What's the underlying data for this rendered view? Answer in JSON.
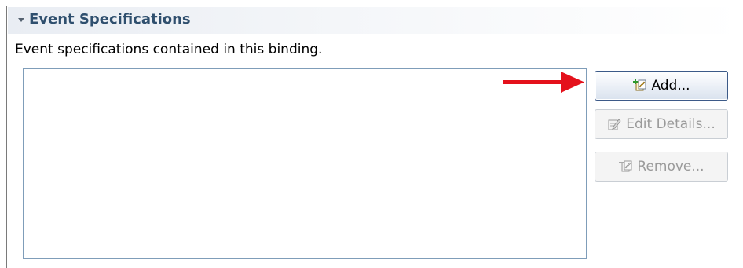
{
  "section": {
    "title": "Event Specifications",
    "description": "Event specifications contained in this binding."
  },
  "buttons": {
    "add": {
      "label": "Add...",
      "icon": "add-event-icon",
      "enabled": true
    },
    "edit": {
      "label": "Edit Details...",
      "icon": "edit-details-icon",
      "enabled": false
    },
    "remove": {
      "label": "Remove...",
      "icon": "remove-event-icon",
      "enabled": false
    }
  },
  "event_specifications": [],
  "colors": {
    "section_title": "#2f4f6e",
    "annotation_arrow": "#e4111b",
    "disabled_text": "#9a9a9a"
  }
}
